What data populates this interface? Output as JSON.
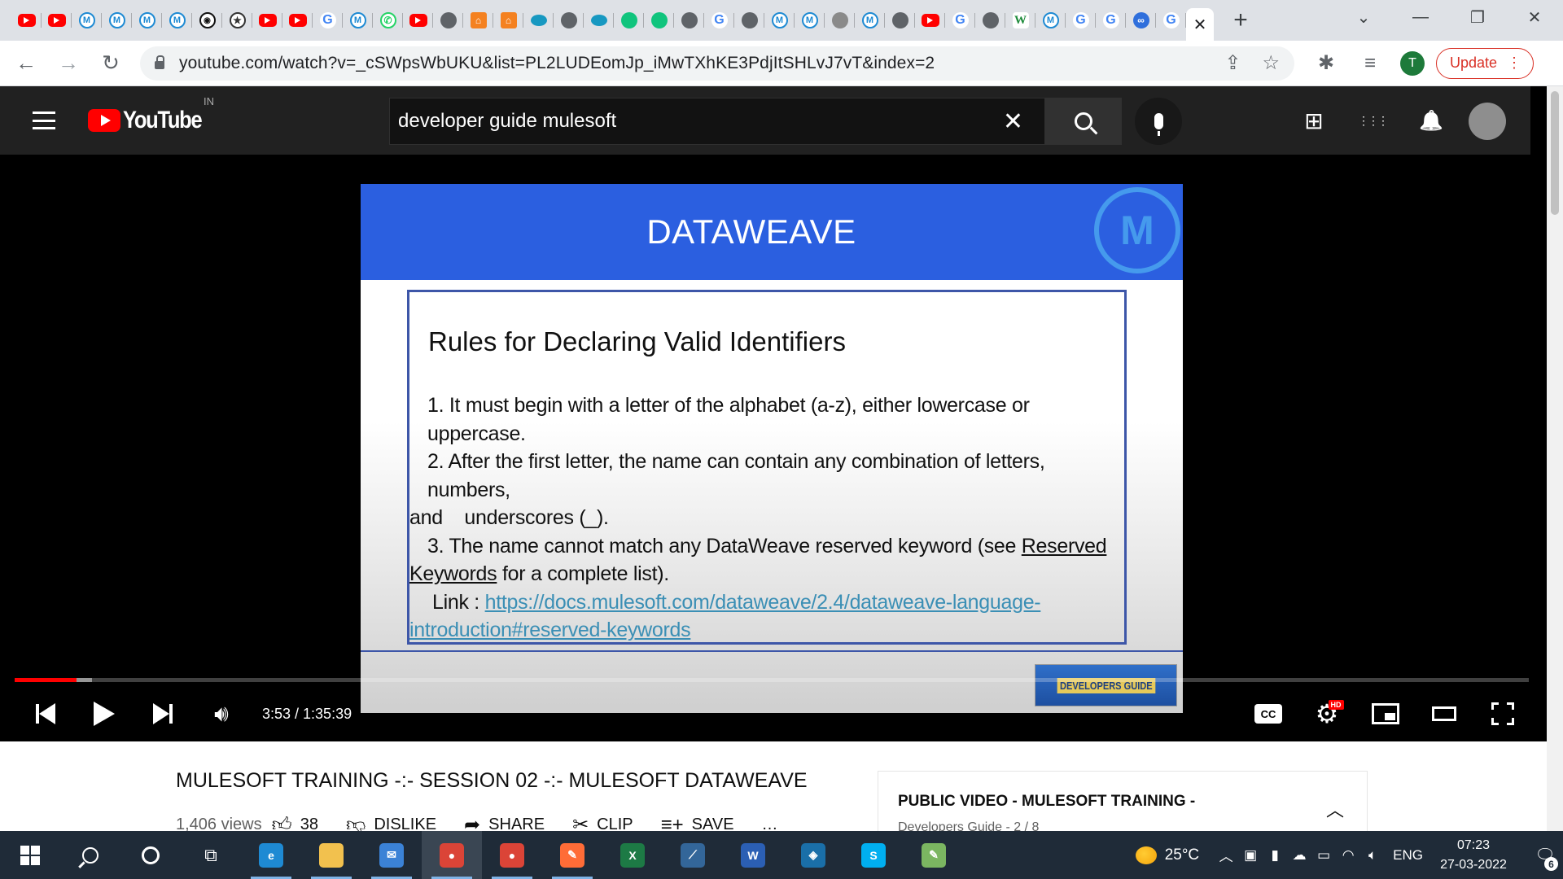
{
  "browser": {
    "tabs_pinned": [
      {
        "icon": "youtube-icon",
        "glyph": ""
      },
      {
        "icon": "youtube-icon",
        "glyph": ""
      },
      {
        "icon": "mulesoft-icon",
        "glyph": "M"
      },
      {
        "icon": "mulesoft-icon",
        "glyph": "M"
      },
      {
        "icon": "mulesoft-icon",
        "glyph": "M"
      },
      {
        "icon": "mulesoft-icon",
        "glyph": "M"
      },
      {
        "icon": "github-icon",
        "glyph": "◉"
      },
      {
        "icon": "star-badge-icon",
        "glyph": "★"
      },
      {
        "icon": "youtube-icon",
        "glyph": ""
      },
      {
        "icon": "youtube-icon",
        "glyph": ""
      },
      {
        "icon": "google-icon",
        "glyph": "G"
      },
      {
        "icon": "mulesoft-icon",
        "glyph": "M"
      },
      {
        "icon": "whatsapp-icon",
        "glyph": "✆"
      },
      {
        "icon": "youtube-icon",
        "glyph": ""
      },
      {
        "icon": "globe-icon",
        "glyph": ""
      },
      {
        "icon": "orange-app-icon",
        "glyph": "⌂"
      },
      {
        "icon": "orange-app-icon",
        "glyph": "⌂"
      },
      {
        "icon": "salesforce-icon",
        "glyph": ""
      },
      {
        "icon": "globe-icon",
        "glyph": ""
      },
      {
        "icon": "salesforce-icon",
        "glyph": ""
      },
      {
        "icon": "green-circle-icon",
        "glyph": ""
      },
      {
        "icon": "green-circle-icon",
        "glyph": ""
      },
      {
        "icon": "globe-icon",
        "glyph": ""
      },
      {
        "icon": "google-icon",
        "glyph": "G"
      },
      {
        "icon": "globe-icon",
        "glyph": ""
      },
      {
        "icon": "mulesoft-icon",
        "glyph": "M"
      },
      {
        "icon": "mulesoft-icon",
        "glyph": "M"
      },
      {
        "icon": "gray-badge-icon",
        "glyph": ""
      },
      {
        "icon": "mulesoft-icon",
        "glyph": "M"
      },
      {
        "icon": "globe-icon",
        "glyph": ""
      },
      {
        "icon": "youtube-icon",
        "glyph": ""
      },
      {
        "icon": "google-icon",
        "glyph": "G"
      },
      {
        "icon": "globe-icon",
        "glyph": ""
      },
      {
        "icon": "wiki-w-icon",
        "glyph": "W"
      },
      {
        "icon": "mulesoft-icon",
        "glyph": "M"
      },
      {
        "icon": "google-icon",
        "glyph": "G"
      },
      {
        "icon": "google-icon",
        "glyph": "G"
      },
      {
        "icon": "link-icon",
        "glyph": "∞"
      },
      {
        "icon": "google-icon",
        "glyph": "G"
      }
    ],
    "active_tab_close": "✕",
    "new_tab": "+",
    "window_controls": {
      "tabsearch": "⌄",
      "minimize": "—",
      "restore": "❐",
      "close": "✕"
    },
    "url": "youtube.com/watch?v=_cSWpsWbUKU&list=PL2LUDEomJp_iMwTXhKE3PdjItSHLvJ7vT&index=2",
    "nav": {
      "back": "←",
      "forward": "→",
      "reload": "↻"
    },
    "omnibox_icons": {
      "share": "⇪",
      "bookmark": "☆"
    },
    "toolbar_icons": {
      "extensions": "✱",
      "reading_list": "≡"
    },
    "profile_initial": "T",
    "update_label": "Update",
    "menu_glyph": "⋮",
    "accent": "#d93025"
  },
  "youtube": {
    "logo_text": "YouTube",
    "country": "IN",
    "search_value": "developer guide mulesoft",
    "clear_glyph": "✕",
    "header_icons": {
      "create": "⊞",
      "apps": "⋮⋮⋮",
      "notifications": "🔔"
    }
  },
  "player": {
    "slide": {
      "title": "DATAWEAVE",
      "logo_glyph": "M",
      "heading": "Rules for Declaring Valid Identifiers",
      "rule1": "1. It must begin with a letter of the alphabet (a-z), either lowercase or uppercase.",
      "rule2a": "2. After the first letter, the name can contain any combination of letters, numbers,",
      "rule2b": "and    underscores (_).",
      "rule3a": "3. The name cannot match any DataWeave reserved keyword (see ",
      "rule3_link1": "Reserved",
      "rule3_link2": "Keywords",
      "rule3b": " for a complete list).",
      "link_label": "Link : ",
      "link_url_a": "https://docs.mulesoft.com/dataweave/2.4/dataweave-language-",
      "link_url_b": "introduction#reserved-keywords",
      "badge": "DEVELOPERS GUIDE"
    },
    "time": "3:53 / 1:35:39",
    "progress": {
      "played_fraction": 0.041,
      "buffered_fraction": 0.051
    },
    "cc_label": "CC",
    "hd_label": "HD",
    "accent": "#ff0000"
  },
  "video": {
    "title": "MULESOFT TRAINING -:- SESSION 02 -:- MULESOFT DATAWEAVE",
    "views": "1,406 views",
    "likes": "38",
    "dislike_label": "DISLIKE",
    "share_label": "SHARE",
    "clip_label": "CLIP",
    "save_label": "SAVE",
    "more_glyph": "…"
  },
  "playlist": {
    "title": "PUBLIC VIDEO - MULESOFT TRAINING -",
    "subtitle": "Developers Guide - 2 / 8",
    "chevron": "︿"
  },
  "taskbar": {
    "apps": [
      {
        "name": "edge-icon",
        "color": "#1e8ad3",
        "glyph": "e"
      },
      {
        "name": "file-explorer-icon",
        "color": "#f2c14e",
        "glyph": ""
      },
      {
        "name": "mail-icon",
        "color": "#3b82d6",
        "glyph": "✉"
      },
      {
        "name": "chrome-icon",
        "color": "#db4437",
        "glyph": "●",
        "active": true
      },
      {
        "name": "chrome-profile-icon",
        "color": "#db4437",
        "glyph": "●"
      },
      {
        "name": "postman-icon",
        "color": "#ff6c37",
        "glyph": "✎"
      },
      {
        "name": "excel-icon",
        "color": "#1d7a45",
        "glyph": "X"
      },
      {
        "name": "mysql-workbench-icon",
        "color": "#336699",
        "glyph": "⟋"
      },
      {
        "name": "word-icon",
        "color": "#2b5fb4",
        "glyph": "W"
      },
      {
        "name": "anypoint-studio-icon",
        "color": "#1a6fa8",
        "glyph": "◈"
      },
      {
        "name": "skype-icon",
        "color": "#00aff0",
        "glyph": "S"
      },
      {
        "name": "notepad-icon",
        "color": "#7bb661",
        "glyph": "✎"
      }
    ],
    "temperature": "25°C",
    "language": "ENG",
    "time": "07:23",
    "date": "27-03-2022",
    "notifications": "6"
  }
}
